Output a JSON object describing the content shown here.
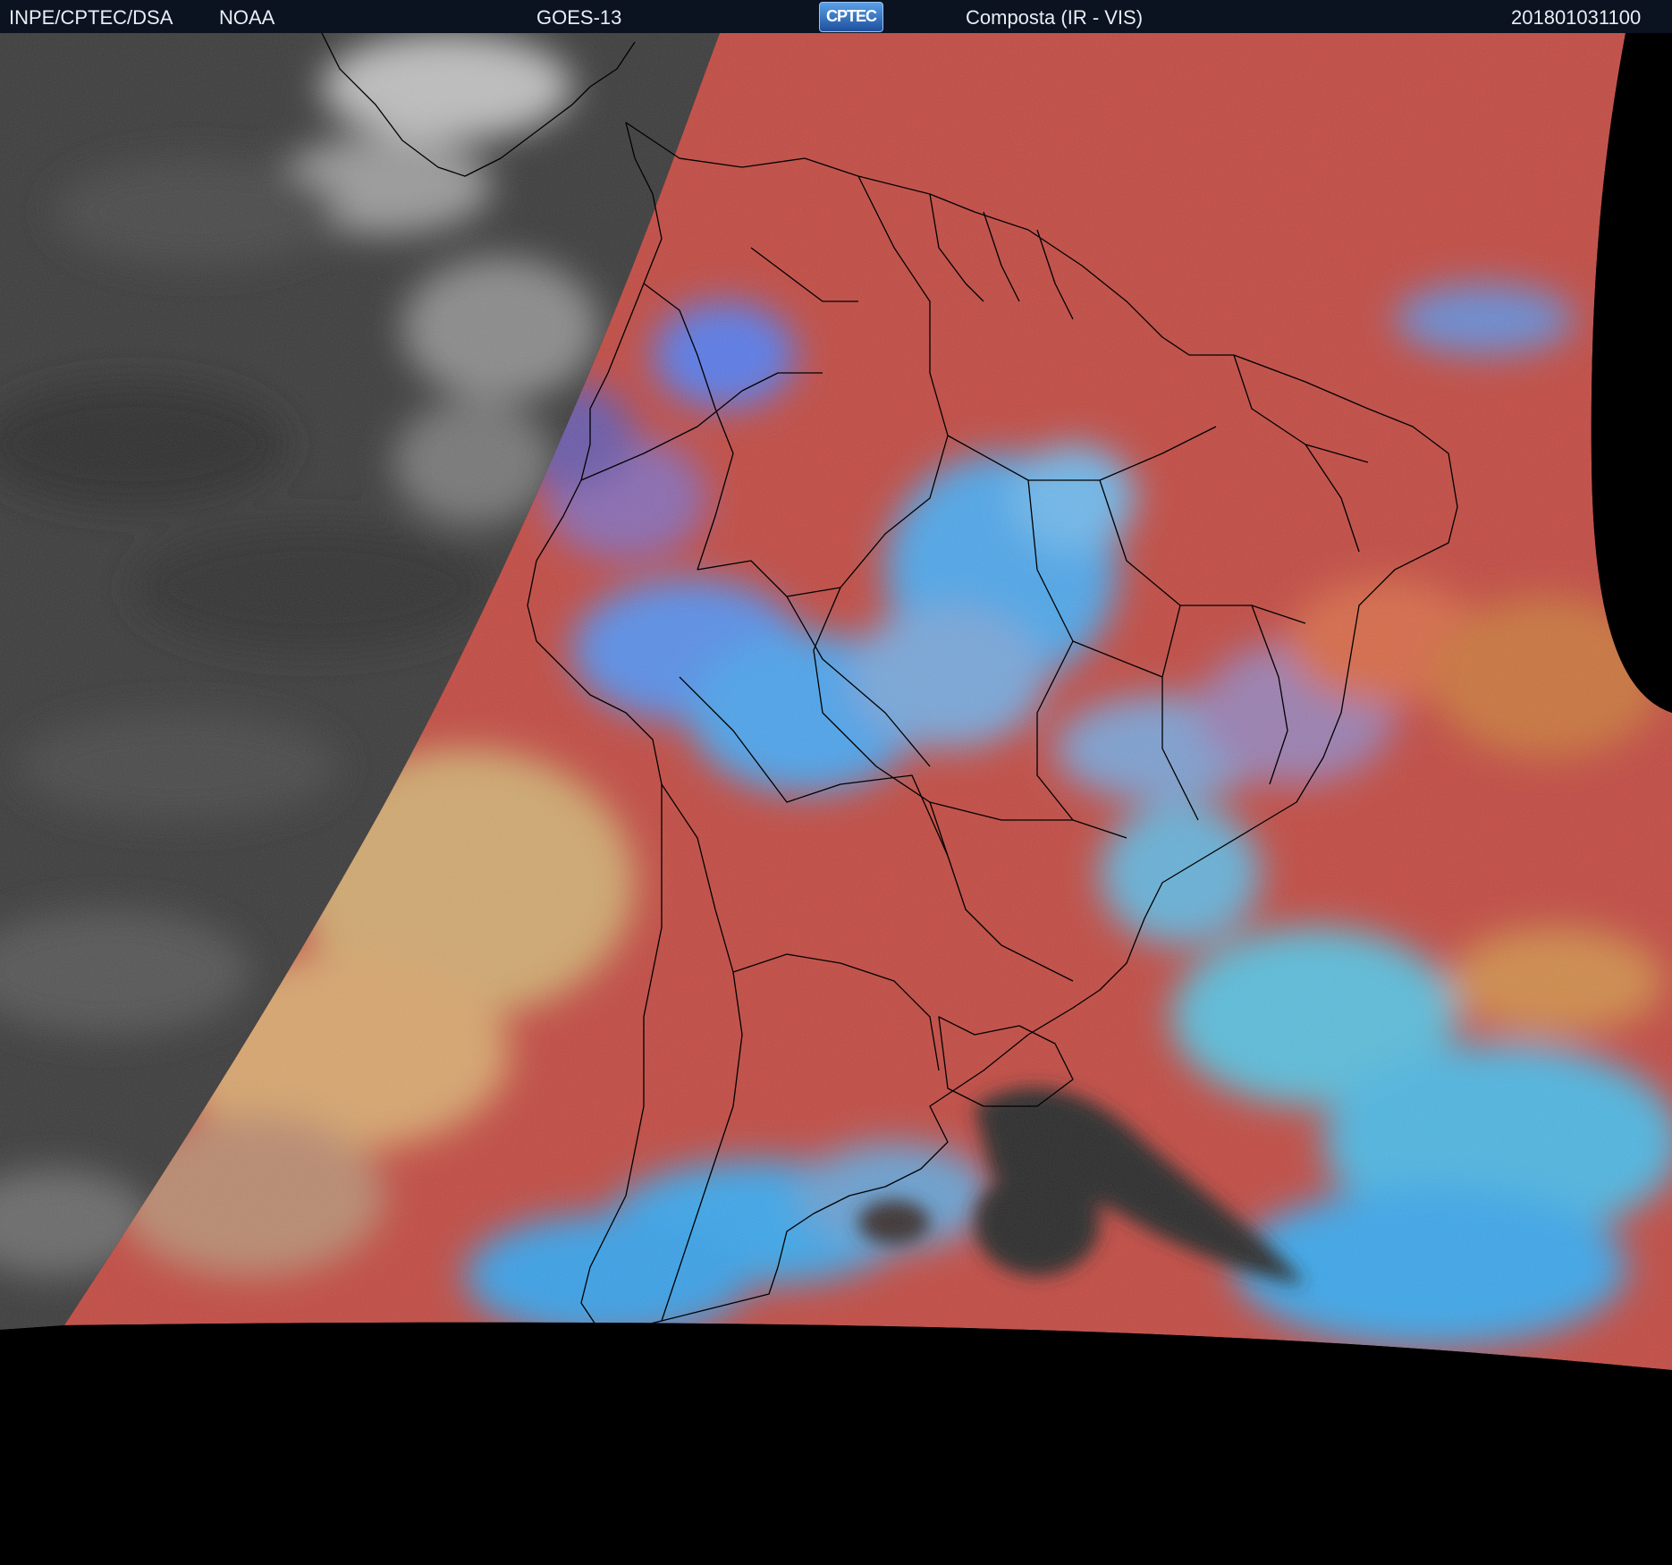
{
  "header": {
    "institution": "INPE/CPTEC/DSA",
    "agency": "NOAA",
    "satellite": "GOES-13",
    "logo_text": "CPTEC",
    "product": "Composta (IR - VIS)",
    "timestamp": "201801031100"
  },
  "colors": {
    "header_bg": "#0b1220",
    "background": "#000000",
    "night_side": "#3a3a3a",
    "day_ocean": "#c14a42",
    "cold_cloud": "#3ea6e8",
    "low_cloud": "#c9a86a",
    "borders": "#000000"
  }
}
